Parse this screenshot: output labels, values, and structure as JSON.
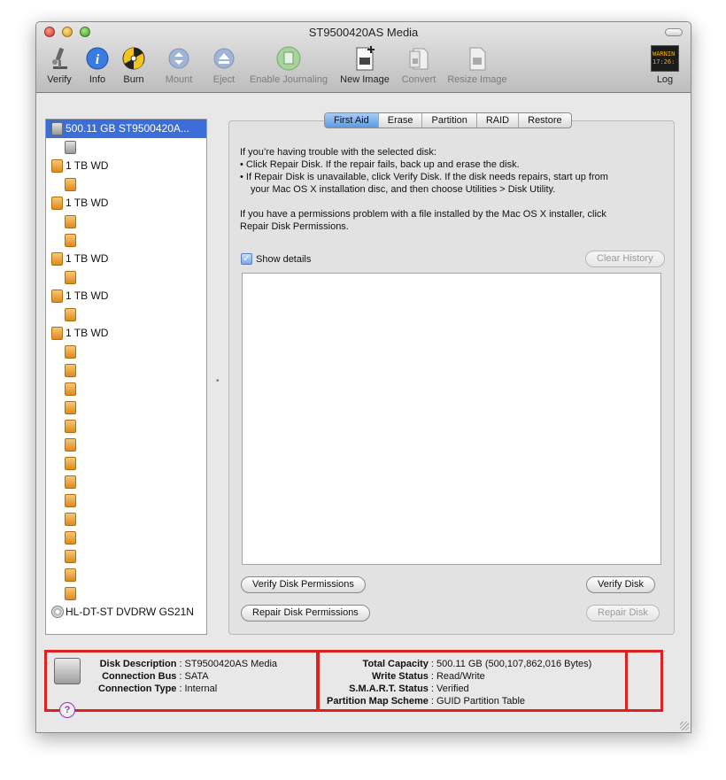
{
  "window": {
    "title": "ST9500420AS Media"
  },
  "toolbar": {
    "items": [
      {
        "label": "Verify",
        "icon": "microscope-icon",
        "enabled": true
      },
      {
        "label": "Info",
        "icon": "info-icon",
        "enabled": true
      },
      {
        "label": "Burn",
        "icon": "burn-icon",
        "enabled": true
      },
      {
        "label": "Mount",
        "icon": "mount-icon",
        "enabled": false
      },
      {
        "label": "Eject",
        "icon": "eject-icon",
        "enabled": false
      },
      {
        "label": "Enable Journaling",
        "icon": "journaling-icon",
        "enabled": false
      },
      {
        "label": "New Image",
        "icon": "new-image-icon",
        "enabled": true
      },
      {
        "label": "Convert",
        "icon": "convert-icon",
        "enabled": false
      },
      {
        "label": "Resize Image",
        "icon": "resize-image-icon",
        "enabled": false
      }
    ],
    "log": {
      "label": "Log",
      "display": "WARNIN",
      "display2": "17:26:"
    }
  },
  "sidebar": {
    "items": [
      {
        "label": "500.11 GB ST9500420A...",
        "level": 0,
        "kind": "hdd",
        "selected": true
      },
      {
        "label": "",
        "level": 1,
        "kind": "hdd"
      },
      {
        "label": "1 TB WD",
        "level": 0,
        "kind": "ext"
      },
      {
        "label": "",
        "level": 1,
        "kind": "ext"
      },
      {
        "label": "1 TB WD",
        "level": 0,
        "kind": "ext"
      },
      {
        "label": "",
        "level": 1,
        "kind": "ext"
      },
      {
        "label": "",
        "level": 1,
        "kind": "ext"
      },
      {
        "label": "1 TB WD",
        "level": 0,
        "kind": "ext"
      },
      {
        "label": "",
        "level": 1,
        "kind": "ext"
      },
      {
        "label": "1 TB WD",
        "level": 0,
        "kind": "ext"
      },
      {
        "label": "",
        "level": 1,
        "kind": "ext"
      },
      {
        "label": "1 TB WD",
        "level": 0,
        "kind": "ext"
      },
      {
        "label": "",
        "level": 1,
        "kind": "ext"
      },
      {
        "label": "",
        "level": 1,
        "kind": "ext"
      },
      {
        "label": "",
        "level": 1,
        "kind": "ext"
      },
      {
        "label": "",
        "level": 1,
        "kind": "ext"
      },
      {
        "label": "",
        "level": 1,
        "kind": "ext"
      },
      {
        "label": "",
        "level": 1,
        "kind": "ext"
      },
      {
        "label": "",
        "level": 1,
        "kind": "ext"
      },
      {
        "label": "",
        "level": 1,
        "kind": "ext"
      },
      {
        "label": "",
        "level": 1,
        "kind": "ext"
      },
      {
        "label": "",
        "level": 1,
        "kind": "ext"
      },
      {
        "label": "",
        "level": 1,
        "kind": "ext"
      },
      {
        "label": "",
        "level": 1,
        "kind": "ext"
      },
      {
        "label": "",
        "level": 1,
        "kind": "ext"
      },
      {
        "label": "",
        "level": 1,
        "kind": "ext"
      },
      {
        "label": "HL-DT-ST DVDRW GS21N",
        "level": 0,
        "kind": "cd"
      }
    ]
  },
  "tabs": [
    "First Aid",
    "Erase",
    "Partition",
    "RAID",
    "Restore"
  ],
  "active_tab": "First Aid",
  "first_aid": {
    "help_intro": "If you’re having trouble with the selected disk:",
    "help_bullet1": "• Click Repair Disk. If the repair fails, back up and erase the disk.",
    "help_bullet2a": "• If Repair Disk is unavailable, click Verify Disk. If the disk needs repairs, start up from",
    "help_bullet2b": "your Mac OS X installation disc, and then choose Utilities > Disk Utility.",
    "help_perm_a": "If you have a permissions problem with a file installed by the Mac OS X installer, click",
    "help_perm_b": "Repair Disk Permissions.",
    "show_details_label": "Show details",
    "show_details_checked": true,
    "clear_history": "Clear History",
    "verify_permissions": "Verify Disk Permissions",
    "repair_permissions": "Repair Disk Permissions",
    "verify_disk": "Verify Disk",
    "repair_disk": "Repair Disk"
  },
  "info": {
    "left": [
      {
        "key": "Disk Description",
        "value": "ST9500420AS Media"
      },
      {
        "key": "Connection Bus",
        "value": "SATA"
      },
      {
        "key": "Connection Type",
        "value": "Internal"
      }
    ],
    "right": [
      {
        "key": "Total Capacity",
        "value": "500.11 GB (500,107,862,016 Bytes)"
      },
      {
        "key": "Write Status",
        "value": "Read/Write"
      },
      {
        "key": "S.M.A.R.T. Status",
        "value": "Verified"
      },
      {
        "key": "Partition Map Scheme",
        "value": "GUID Partition Table"
      }
    ],
    "help_glyph": "?",
    "highlight_color": "#e0201f"
  }
}
